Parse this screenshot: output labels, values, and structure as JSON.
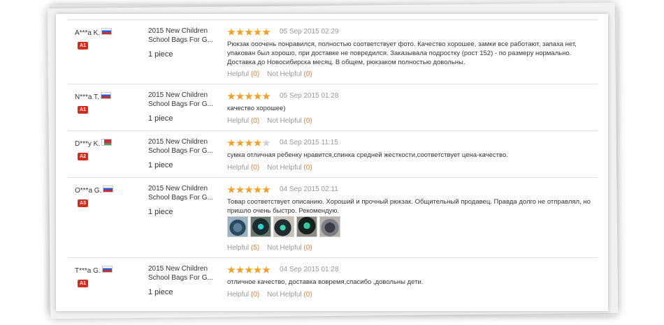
{
  "reviews": [
    {
      "user": "A***a K.",
      "flag": "ru-flag-icon",
      "badge": "A1",
      "product": "2015 New Children School Bags For G...",
      "quantity": "1 piece",
      "rating": 5,
      "date": "05 Sep 2015 02:29",
      "text": "Рюкзак ооочень понравился, полностью соответствует фото. Качество хорошее, замки все работают, запаха нет, упакован был хорошо, при доставке не повредился. Заказывала подростку (рост 152) - по размеру нормально. Доставка до Новосибирска месяц. В общем, рюкзаком полностью довольны.",
      "helpful_label": "Helpful",
      "helpful_count": "(0)",
      "not_helpful_label": "Not Helpful",
      "not_helpful_count": "(0)"
    },
    {
      "user": "N***a T.",
      "flag": "ru-flag-icon",
      "badge": "A1",
      "product": "2015 New Children School Bags For G...",
      "quantity": "1 piece",
      "rating": 5,
      "date": "05 Sep 2015 01:28",
      "text": "качество хорошее)",
      "helpful_label": "Helpful",
      "helpful_count": "(0)",
      "not_helpful_label": "Not Helpful",
      "not_helpful_count": "(0)"
    },
    {
      "user": "D***y K.",
      "flag": "by-flag-icon",
      "badge": "A2",
      "product": "2015 New Children School Bags For G...",
      "quantity": "1 piece",
      "rating": 4,
      "date": "04 Sep 2015 11:15",
      "text": "сумка отличная ребенку нравится,спинка средней жесткости,соответствует цена-качество.",
      "helpful_label": "Helpful",
      "helpful_count": "(0)",
      "not_helpful_label": "Not Helpful",
      "not_helpful_count": "(0)"
    },
    {
      "user": "O***a G.",
      "flag": "ru-flag-icon",
      "badge": "A3",
      "product": "2015 New Children School Bags For G...",
      "quantity": "1 piece",
      "rating": 5,
      "date": "04 Sep 2015 02:11",
      "text": "Товар соответствует описанию. Хороший и прочный рюкзак. Общительный продавец. Правда долго не отправлял, но пришло очень быстро. Рекомендую.",
      "photos": 5,
      "helpful_label": "Helpful",
      "helpful_count": "(5)",
      "not_helpful_label": "Not Helpful",
      "not_helpful_count": "(0)"
    },
    {
      "user": "T***a G.",
      "flag": "ru-flag-icon",
      "badge": "A1",
      "product": "2015 New Children School Bags For G...",
      "quantity": "1 piece",
      "rating": 5,
      "date": "04 Sep 2015 01:28",
      "text": "отличное качество, доставка вовремя,спасибо ,довольны дети.",
      "helpful_label": "Helpful",
      "helpful_count": "(0)",
      "not_helpful_label": "Not Helpful",
      "not_helpful_count": "(0)"
    }
  ],
  "colors": {
    "star": "#f08a00",
    "badge": "#d42c1b",
    "count": "#e4823f"
  }
}
